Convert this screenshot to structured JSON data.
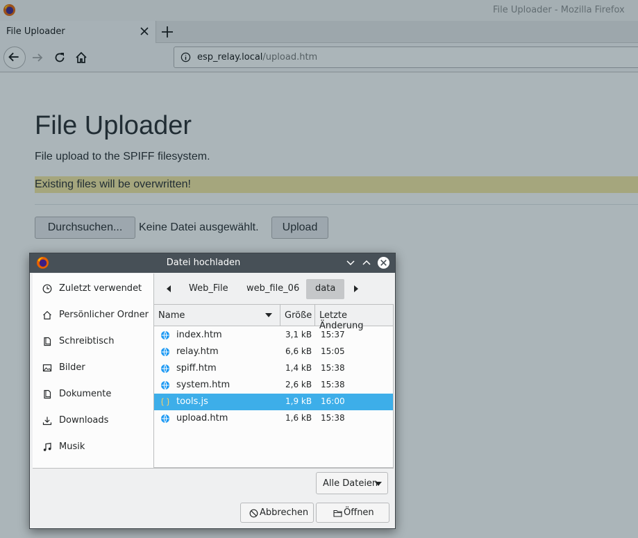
{
  "window": {
    "title": "File Uploader - Mozilla Firefox"
  },
  "tab": {
    "label": "File Uploader"
  },
  "urlbar": {
    "host": "esp_relay.local",
    "path": "/upload.htm"
  },
  "page": {
    "title": "File Uploader",
    "subtitle": "File upload to the SPIFF filesystem.",
    "warning": "Existing files will be overwritten!",
    "browse_label": "Durchsuchen...",
    "no_file_label": "Keine Datei ausgewählt.",
    "upload_label": "Upload"
  },
  "dialog": {
    "title": "Datei hochladen",
    "places": [
      {
        "label": "Zuletzt verwendet",
        "icon": "clock-icon"
      },
      {
        "label": "Persönlicher Ordner",
        "icon": "home-icon"
      },
      {
        "label": "Schreibtisch",
        "icon": "desktop-icon"
      },
      {
        "label": "Bilder",
        "icon": "pictures-icon"
      },
      {
        "label": "Dokumente",
        "icon": "documents-icon"
      },
      {
        "label": "Downloads",
        "icon": "download-icon"
      },
      {
        "label": "Musik",
        "icon": "music-icon"
      }
    ],
    "breadcrumbs": [
      "Web_File",
      "web_file_06",
      "data"
    ],
    "columns": {
      "name": "Name",
      "size": "Größe",
      "modified": "Letzte Änderung"
    },
    "files": [
      {
        "name": "index.htm",
        "size": "3,1 kB",
        "modified": "15:37",
        "icon": "web-file-icon",
        "selected": false
      },
      {
        "name": "relay.htm",
        "size": "6,6 kB",
        "modified": "15:05",
        "icon": "web-file-icon",
        "selected": false
      },
      {
        "name": "spiff.htm",
        "size": "1,4 kB",
        "modified": "15:38",
        "icon": "web-file-icon",
        "selected": false
      },
      {
        "name": "system.htm",
        "size": "2,6 kB",
        "modified": "15:38",
        "icon": "web-file-icon",
        "selected": false
      },
      {
        "name": "tools.js",
        "size": "1,9 kB",
        "modified": "16:00",
        "icon": "script-file-icon",
        "selected": true
      },
      {
        "name": "upload.htm",
        "size": "1,6 kB",
        "modified": "15:38",
        "icon": "web-file-icon",
        "selected": false
      }
    ],
    "filter_label": "Alle Dateien",
    "cancel_label": "Abbrechen",
    "open_label": "Öffnen"
  },
  "colors": {
    "selection": "#3daee9",
    "warning_bg": "#f5e79e",
    "dialog_titlebar": "#475057"
  }
}
